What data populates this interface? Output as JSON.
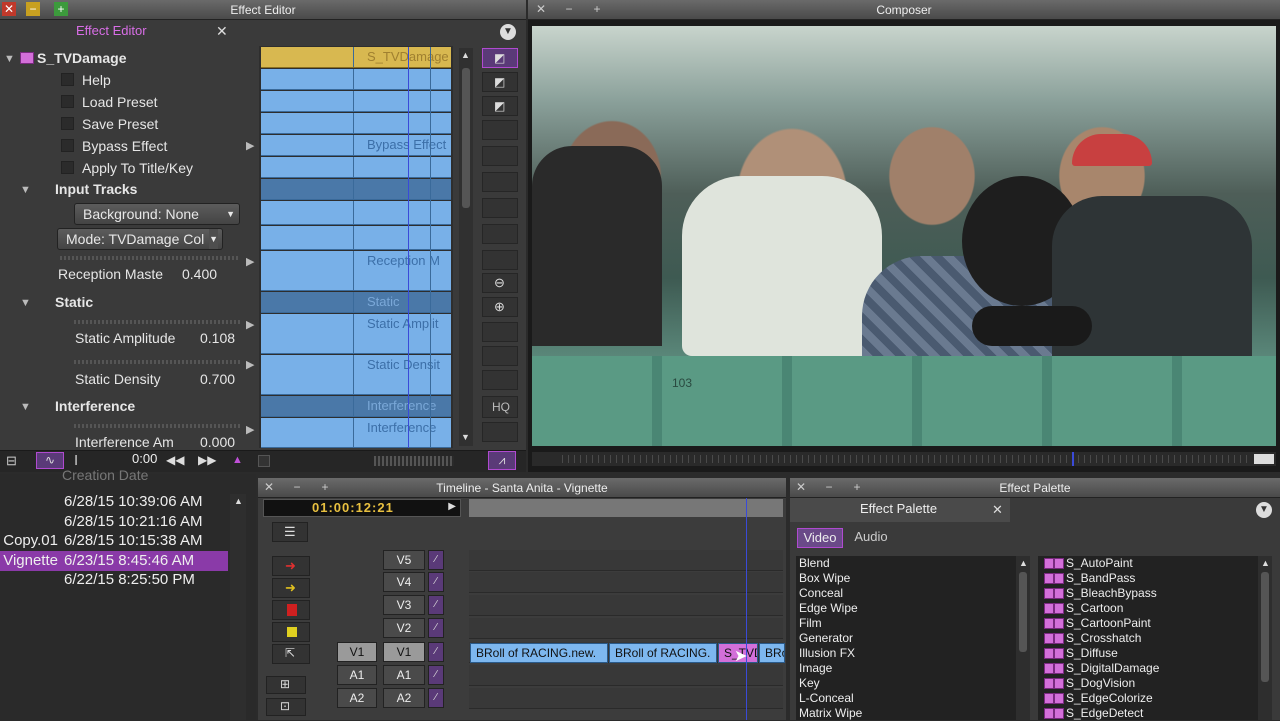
{
  "effect_editor": {
    "window_title": "Effect Editor",
    "tab_label": "Effect Editor",
    "effect_name": "S_TVDamage",
    "items": {
      "help": "Help",
      "load_preset": "Load Preset",
      "save_preset": "Save Preset",
      "bypass_effect": "Bypass Effect",
      "apply_title": "Apply To Title/Key",
      "input_tracks": "Input Tracks",
      "background_dropdown": "Background: None",
      "mode_dropdown": "Mode: TVDamage Col",
      "reception_label": "Reception Maste",
      "reception_value": "0.400",
      "static_group": "Static",
      "static_amp_label": "Static Amplitude",
      "static_amp_value": "0.108",
      "static_density_label": "Static Density",
      "static_density_value": "0.700",
      "interference_group": "Interference",
      "interference_label": "Interference Am",
      "interference_value": "0.000"
    },
    "keyframe_labels": {
      "name": "S_TVDamage",
      "bypass": "Bypass Effect",
      "reception": "Reception M",
      "static": "Static",
      "static_amp": "Static Amplit",
      "static_density": "Static Densit",
      "interference": "Interference",
      "interference_am": "Interference"
    },
    "timecode": "0:00",
    "hq_label": "HQ"
  },
  "composer": {
    "window_title": "Composer",
    "frame_labels": {
      "seat_number": "103"
    }
  },
  "bin": {
    "header": "Creation Date",
    "rows": [
      {
        "name": "",
        "date": "6/28/15 10:39:06 AM"
      },
      {
        "name": "",
        "date": "6/28/15 10:21:16 AM"
      },
      {
        "name": "Copy.01",
        "date": "6/28/15 10:15:38 AM"
      },
      {
        "name": "Vignette",
        "date": "6/23/15 8:45:46 AM",
        "selected": true
      },
      {
        "name": "",
        "date": "6/22/15 8:25:50 PM"
      }
    ]
  },
  "timeline": {
    "window_title": "Timeline - Santa Anita - Vignette",
    "timecode": "01:00:12:21",
    "tracks": [
      "V5",
      "V4",
      "V3",
      "V2",
      "V1",
      "A1",
      "A2"
    ],
    "source_tracks": {
      "v1": "V1",
      "a1": "A1",
      "a2": "A2"
    },
    "clips": [
      {
        "label": "BRoll of RACING.new."
      },
      {
        "label": "BRoll of RACING."
      },
      {
        "label": "S_TVD"
      },
      {
        "label": "BRo"
      }
    ]
  },
  "effect_palette": {
    "window_title": "Effect Palette",
    "tab_label": "Effect Palette",
    "tabs": [
      "Video",
      "Audio"
    ],
    "categories": [
      "Blend",
      "Box Wipe",
      "Conceal",
      "Edge Wipe",
      "Film",
      "Generator",
      "Illusion FX",
      "Image",
      "Key",
      "L-Conceal",
      "Matrix Wipe"
    ],
    "effects": [
      "S_AutoPaint",
      "S_BandPass",
      "S_BleachBypass",
      "S_Cartoon",
      "S_CartoonPaint",
      "S_Crosshatch",
      "S_Diffuse",
      "S_DigitalDamage",
      "S_DogVision",
      "S_EdgeColorize",
      "S_EdgeDetect"
    ]
  },
  "colors": {
    "accent_purple": "#b04ad0",
    "keyframe_blue": "#78b0e8",
    "clip_blue": "#7db7ef",
    "effect_magenta": "#d36fd9",
    "selection_purple": "#8a3aa8"
  }
}
